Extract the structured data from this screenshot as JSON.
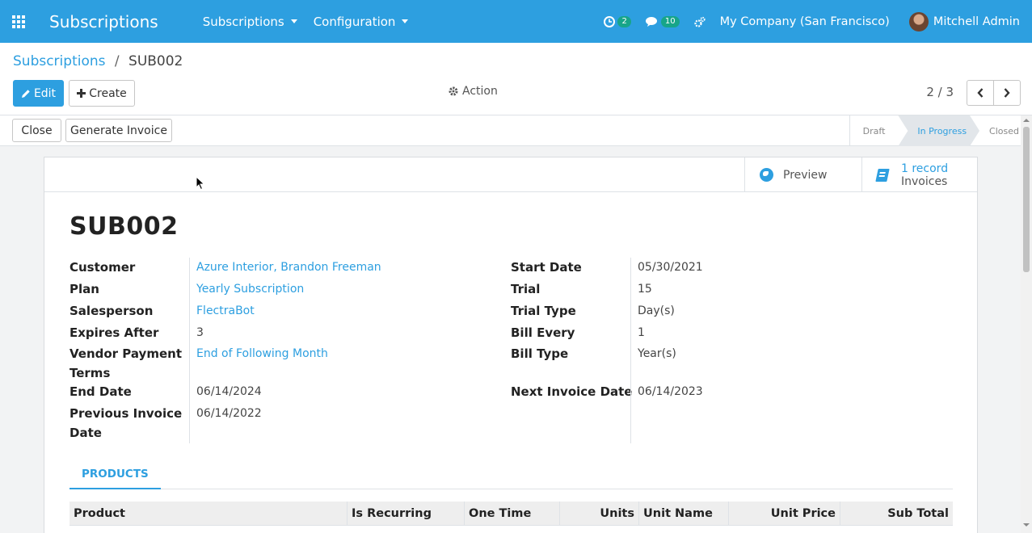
{
  "navbar": {
    "app_name": "Subscriptions",
    "menus": [
      "Subscriptions",
      "Configuration"
    ],
    "activity_badge": "2",
    "messages_badge": "10",
    "company": "My Company (San Francisco)",
    "user": "Mitchell Admin"
  },
  "breadcrumb": {
    "parent": "Subscriptions",
    "separator": "/",
    "current": "SUB002"
  },
  "toolbar": {
    "edit_label": "Edit",
    "create_label": "Create",
    "action_label": "Action"
  },
  "pager": {
    "value": "2 / 3"
  },
  "statusbar": {
    "buttons": [
      "Close",
      "Generate Invoice"
    ],
    "stages": [
      "Draft",
      "In Progress",
      "Closed"
    ],
    "active_stage": "In Progress"
  },
  "smart_buttons": {
    "preview_label": "Preview",
    "invoices_value": "1 record",
    "invoices_label": "Invoices"
  },
  "form": {
    "title": "SUB002",
    "left": {
      "customer_label": "Customer",
      "customer_value": "Azure Interior, Brandon Freeman",
      "plan_label": "Plan",
      "plan_value": "Yearly Subscription",
      "salesperson_label": "Salesperson",
      "salesperson_value": "FlectraBot",
      "expires_label": "Expires After",
      "expires_value": "3",
      "payment_terms_label": "Vendor Payment Terms",
      "payment_terms_value": "End of Following Month",
      "end_date_label": "End Date",
      "end_date_value": "06/14/2024",
      "prev_invoice_label": "Previous Invoice Date",
      "prev_invoice_value": "06/14/2022"
    },
    "right": {
      "start_date_label": "Start Date",
      "start_date_value": "05/30/2021",
      "trial_label": "Trial",
      "trial_value": "15",
      "trial_type_label": "Trial Type",
      "trial_type_value": "Day(s)",
      "bill_every_label": "Bill Every",
      "bill_every_value": "1",
      "bill_type_label": "Bill Type",
      "bill_type_value": "Year(s)",
      "next_invoice_label": "Next Invoice Date",
      "next_invoice_value": "06/14/2023"
    }
  },
  "tabs": [
    "PRODUCTS"
  ],
  "table": {
    "columns": [
      "Product",
      "Is Recurring",
      "One Time",
      "Units",
      "Unit Name",
      "Unit Price",
      "Sub Total"
    ]
  },
  "colors": {
    "brand": "#2d9fe0",
    "badge": "#17a589"
  }
}
